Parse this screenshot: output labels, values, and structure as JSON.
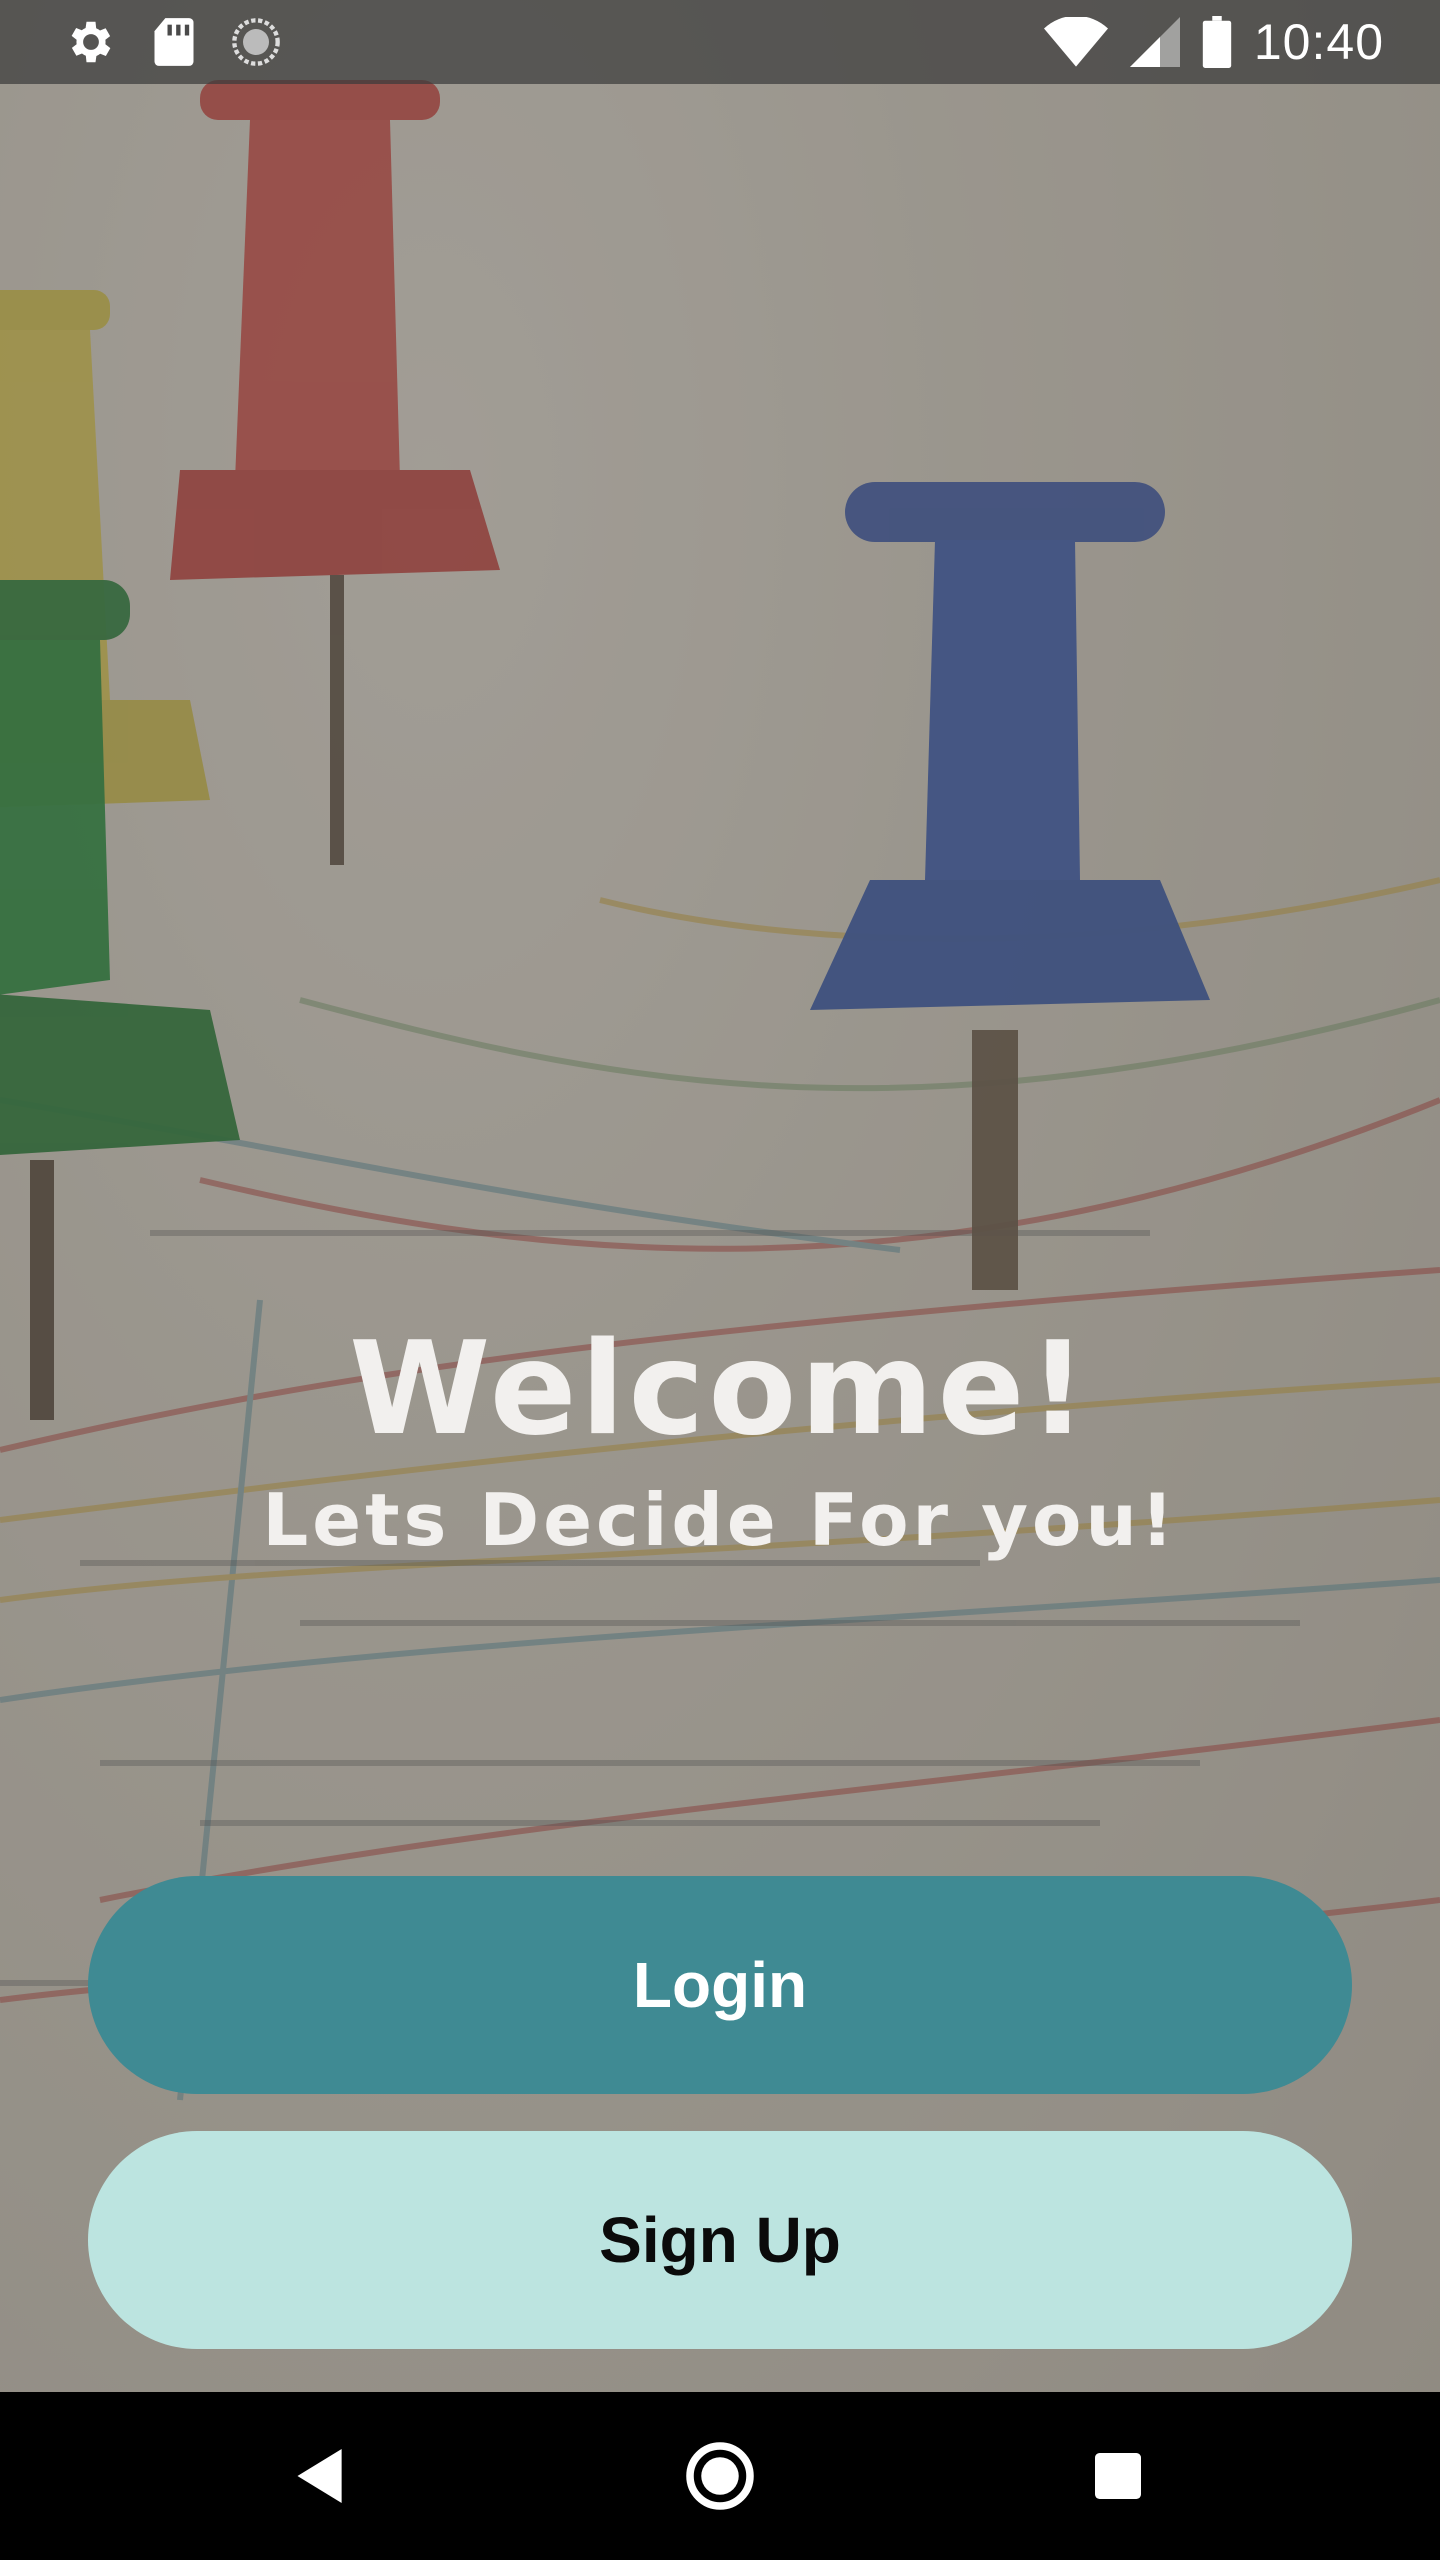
{
  "status_bar": {
    "time": "10:40",
    "left_icons": [
      "settings-icon",
      "sd-card-icon",
      "sync-icon"
    ],
    "right_icons": [
      "wifi-icon",
      "cellular-signal-icon",
      "battery-icon"
    ]
  },
  "headline": {
    "title": "Welcome!",
    "subtitle": "Lets Decide For you!"
  },
  "buttons": {
    "login_label": "Login",
    "signup_label": "Sign Up"
  },
  "nav_bar": {
    "icons": [
      "back-icon",
      "home-icon",
      "recents-icon"
    ]
  },
  "colors": {
    "login_button": "#3f8a93",
    "signup_button": "#bce4e0",
    "text_light": "#f2f0ee"
  }
}
